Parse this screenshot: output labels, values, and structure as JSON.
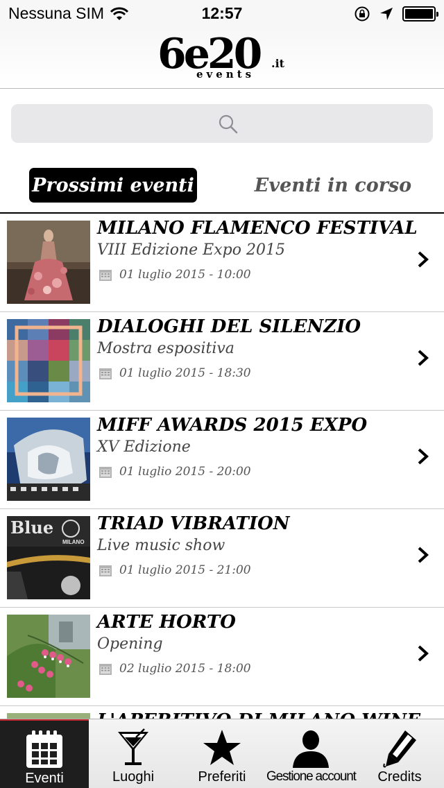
{
  "status_bar": {
    "carrier": "Nessuna SIM",
    "time": "12:57"
  },
  "header": {
    "logo_main": "6e20",
    "logo_tld": ".it",
    "logo_sub": "events"
  },
  "search": {
    "placeholder": ""
  },
  "tabs": {
    "active": "Prossimi eventi",
    "inactive": "Eventi in corso"
  },
  "events": [
    {
      "title": "MILANO FLAMENCO FESTIVAL",
      "subtitle": "VIII Edizione Expo 2015",
      "date": "01 luglio 2015 - 10:00"
    },
    {
      "title": "DIALOGHI DEL SILENZIO",
      "subtitle": "Mostra espositiva",
      "date": "01 luglio 2015 - 18:30"
    },
    {
      "title": "MIFF AWARDS 2015 EXPO",
      "subtitle": "XV Edizione",
      "date": "01 luglio 2015 - 20:00"
    },
    {
      "title": "TRIAD VIBRATION",
      "subtitle": "Live music show",
      "date": "01 luglio 2015 - 21:00"
    },
    {
      "title": "ARTE HORTO",
      "subtitle": "Opening",
      "date": "02 luglio 2015 - 18:00"
    },
    {
      "title": "L'APERITIVO DI MILANO WINE",
      "subtitle": "",
      "date": ""
    }
  ],
  "thumb_text": {
    "triad_sign": "Blue",
    "triad_city": "MILANO"
  },
  "tab_bar": {
    "items": [
      {
        "label": "Eventi",
        "icon": "calendar-icon",
        "active": true
      },
      {
        "label": "Luoghi",
        "icon": "cocktail-icon",
        "active": false
      },
      {
        "label": "Preferiti",
        "icon": "star-icon",
        "active": false
      },
      {
        "label": "Gestione account",
        "icon": "person-icon",
        "active": false
      },
      {
        "label": "Credits",
        "icon": "pen-icon",
        "active": false
      }
    ]
  },
  "colors": {
    "tab_active_bg": "#000000",
    "tabbar_active_bg": "#1e1e1e",
    "tabbar_active_accent": "#c1272d",
    "search_bg": "#e8e8ea"
  }
}
